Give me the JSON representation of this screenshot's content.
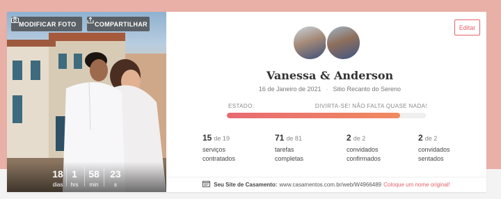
{
  "photo": {
    "modify_label": "MODIFICAR FOTO",
    "share_label": "COMPARTILHAR",
    "countdown": [
      {
        "value": "18",
        "unit": "dias"
      },
      {
        "value": "1",
        "unit": "hrs"
      },
      {
        "value": "58",
        "unit": "min"
      },
      {
        "value": "23",
        "unit": "s"
      }
    ]
  },
  "edit_label": "Editar",
  "couple": "Vanessa & Anderson",
  "event": {
    "date": "16 de Janeiro de 2021",
    "venue": "Sitio Recanto do Sereno"
  },
  "status": {
    "label": "ESTADO:",
    "message": "DIVIRTA-SE! NÃO FALTA QUASE NADA!",
    "progress": 0.87
  },
  "stats": [
    {
      "done": "15",
      "of": "de 19",
      "line1": "serviços",
      "line2": "contratados"
    },
    {
      "done": "71",
      "of": "de 81",
      "line1": "tarefas",
      "line2": "completas"
    },
    {
      "done": "2",
      "of": "de 2",
      "line1": "convidados",
      "line2": "confirmados"
    },
    {
      "done": "2",
      "of": "de 2",
      "line1": "convidados",
      "line2": "sentados"
    }
  ],
  "footer": {
    "label": "Seu Site de Casamento:",
    "url": "www.casamentos.com.br/web/W4966489",
    "cta": "Coloque um nome original!"
  },
  "colors": {
    "accent": "#e4606a",
    "band": "#e9b0a8"
  },
  "icons": {
    "camera": "camera-icon",
    "share": "share-icon",
    "website": "website-icon"
  }
}
